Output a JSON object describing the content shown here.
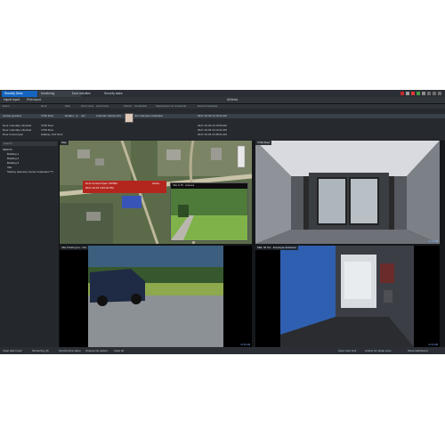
{
  "tabs": [
    {
      "label": "Security Desk",
      "active": true
    },
    {
      "label": "Monitoring",
      "active": false
    },
    {
      "label": "Door activities",
      "active": false
    },
    {
      "label": "Security tasks",
      "active": false
    }
  ],
  "header_right": "All items",
  "toolbar": {
    "left1": "Import report",
    "left2": "Print report"
  },
  "events": {
    "columns": [
      "Event",
      "Door",
      "Side",
      "First name",
      "Last name",
      "Picture",
      "Credential",
      "Suppressed on credential",
      "Event timestamp"
    ],
    "rows": [
      {
        "event": "Access granted",
        "door": "V700 Door",
        "side": "Reader - A",
        "first": "Jon",
        "last": "Coleman (Verde,CO)",
        "credential": "Jon Coleman credential",
        "timestamp": "2017-10-03 11:16:41 AM"
      },
      {
        "event": "Door manually unlocked",
        "door": "V700 Door",
        "side": "",
        "first": "",
        "last": "",
        "credential": "",
        "timestamp": "2017-10-03 11:15:55 AM"
      },
      {
        "event": "Door manually unlocked",
        "door": "V700 Door",
        "side": "",
        "first": "",
        "last": "",
        "credential": "",
        "timestamp": "2017-10-03 11:13:41 AM"
      },
      {
        "event": "Door forced open",
        "door": "Hallway, 2nd Floor",
        "side": "",
        "first": "",
        "last": "",
        "credential": "",
        "timestamp": "2017-10-03 11:08:51 AM"
      }
    ]
  },
  "tree": {
    "search": "Search",
    "nodes": [
      "REDOS",
      "Building 1",
      "Building 2",
      "Building 3",
      "VEL",
      "Stanley (Security Center Federation™)"
    ]
  },
  "tiles": {
    "map": {
      "caption": "Map",
      "alarm_title": "Door Forced Open: M7990",
      "alarm_time": "2017-10-15 4:32:42 PM",
      "alarm_status": "Active",
      "inset_caption": "VEL & 75 - Camera"
    },
    "door": {
      "caption": "V700 Door",
      "timestamp": "11:14 AM"
    },
    "parking": {
      "caption": "VEL Parking lot - Out",
      "timestamp": "11:15 AM"
    },
    "entrance": {
      "caption": "MEL 40 G2 - Employee Entrance",
      "timestamp": "11:14 AM"
    }
  },
  "statusbar": {
    "items": [
      "Clear alarm lock",
      "Monitoring (0)",
      "Synchronize video",
      "Change tile pattern",
      "Clear all"
    ],
    "right": [
      "Open door lock",
      "Unlock for single entry",
      "Show dashboard"
    ]
  },
  "colors": {
    "accent": "#1565c0",
    "alarm": "#b3261e"
  }
}
